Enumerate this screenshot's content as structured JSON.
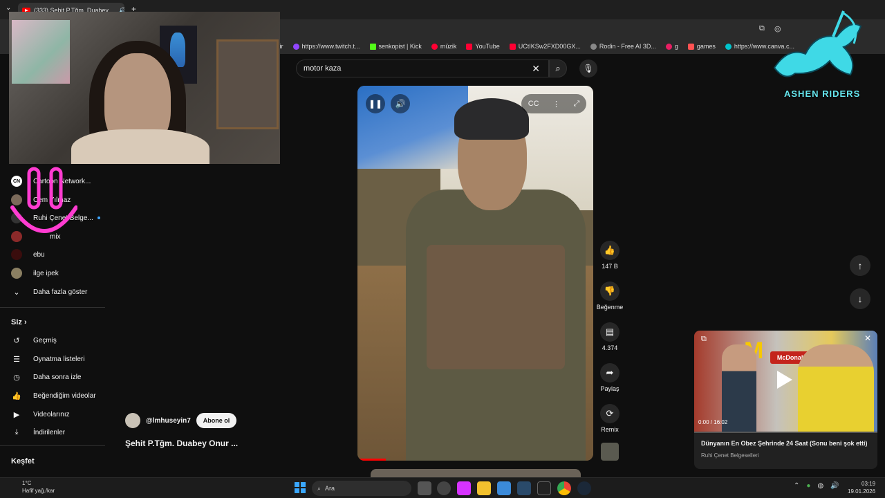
{
  "browser": {
    "tab_title": "(333) Şehit P.Tğm. Duabey ...",
    "bookmarks": [
      {
        "label": "vir",
        "color": "#6b6b6b"
      },
      {
        "label": "https://www.twitch.t...",
        "color": "#9146ff"
      },
      {
        "label": "senkopist | Kick",
        "color": "#53fc18"
      },
      {
        "label": "müzik",
        "color": "#ff0033"
      },
      {
        "label": "YouTube",
        "color": "#ff0033"
      },
      {
        "label": "UCtIKSw2FXD00GX...",
        "color": "#ff0033"
      },
      {
        "label": "Rodin - Free AI 3D...",
        "color": "#888888"
      },
      {
        "label": "g",
        "color": "#e91e63"
      },
      {
        "label": "games",
        "color": "#ff5252"
      },
      {
        "label": "https://www.canva.c...",
        "color": "#00c4cc"
      }
    ]
  },
  "search": {
    "value": "motor kaza"
  },
  "sidebar": {
    "subscriptions": [
      {
        "label": "Cartoon Network...",
        "badge": "live"
      },
      {
        "label": "Cem Yılmaz",
        "badge": ""
      },
      {
        "label": "Ruhi Çenet Belge...",
        "badge": "dot"
      },
      {
        "label": "mix",
        "badge": ""
      },
      {
        "label": "ebu",
        "badge": ""
      },
      {
        "label": "ilge ipek",
        "badge": ""
      }
    ],
    "show_more": "Daha fazla göster",
    "you_heading": "Siz",
    "you_items": [
      {
        "label": "Geçmiş",
        "icon": "history-icon"
      },
      {
        "label": "Oynatma listeleri",
        "icon": "playlist-icon"
      },
      {
        "label": "Daha sonra izle",
        "icon": "clock-icon"
      },
      {
        "label": "Beğendiğim videolar",
        "icon": "like-icon"
      },
      {
        "label": "Videolarınız",
        "icon": "video-icon"
      },
      {
        "label": "İndirilenler",
        "icon": "download-icon"
      }
    ],
    "explore_heading": "Keşfet"
  },
  "short": {
    "progress": 0.12,
    "likes": "147 B",
    "dislike_label": "Beğenme",
    "comments": "4.374",
    "share_label": "Paylaş",
    "remix_label": "Remix",
    "channel": "@lmhuseyin7",
    "subscribe_label": "Abone ol",
    "title": "Şehit P.Tğm. Duabey Onur ..."
  },
  "mini_player": {
    "time": "0:00 / 16:02",
    "title": "Dünyanın En Obez Şehrinde 24 Saat (Sonu beni şok etti)",
    "channel": "Ruhi Çenet Belgeselleri",
    "sign_text": "McDonald's",
    "arches": "M"
  },
  "overlay_logo": {
    "text": "ASHEN RIDERS"
  },
  "taskbar": {
    "weather_temp": "1°C",
    "weather_desc": "Hafif yağ./kar",
    "search_placeholder": "Ara",
    "time": "03:19",
    "date": "19.01.2026"
  }
}
